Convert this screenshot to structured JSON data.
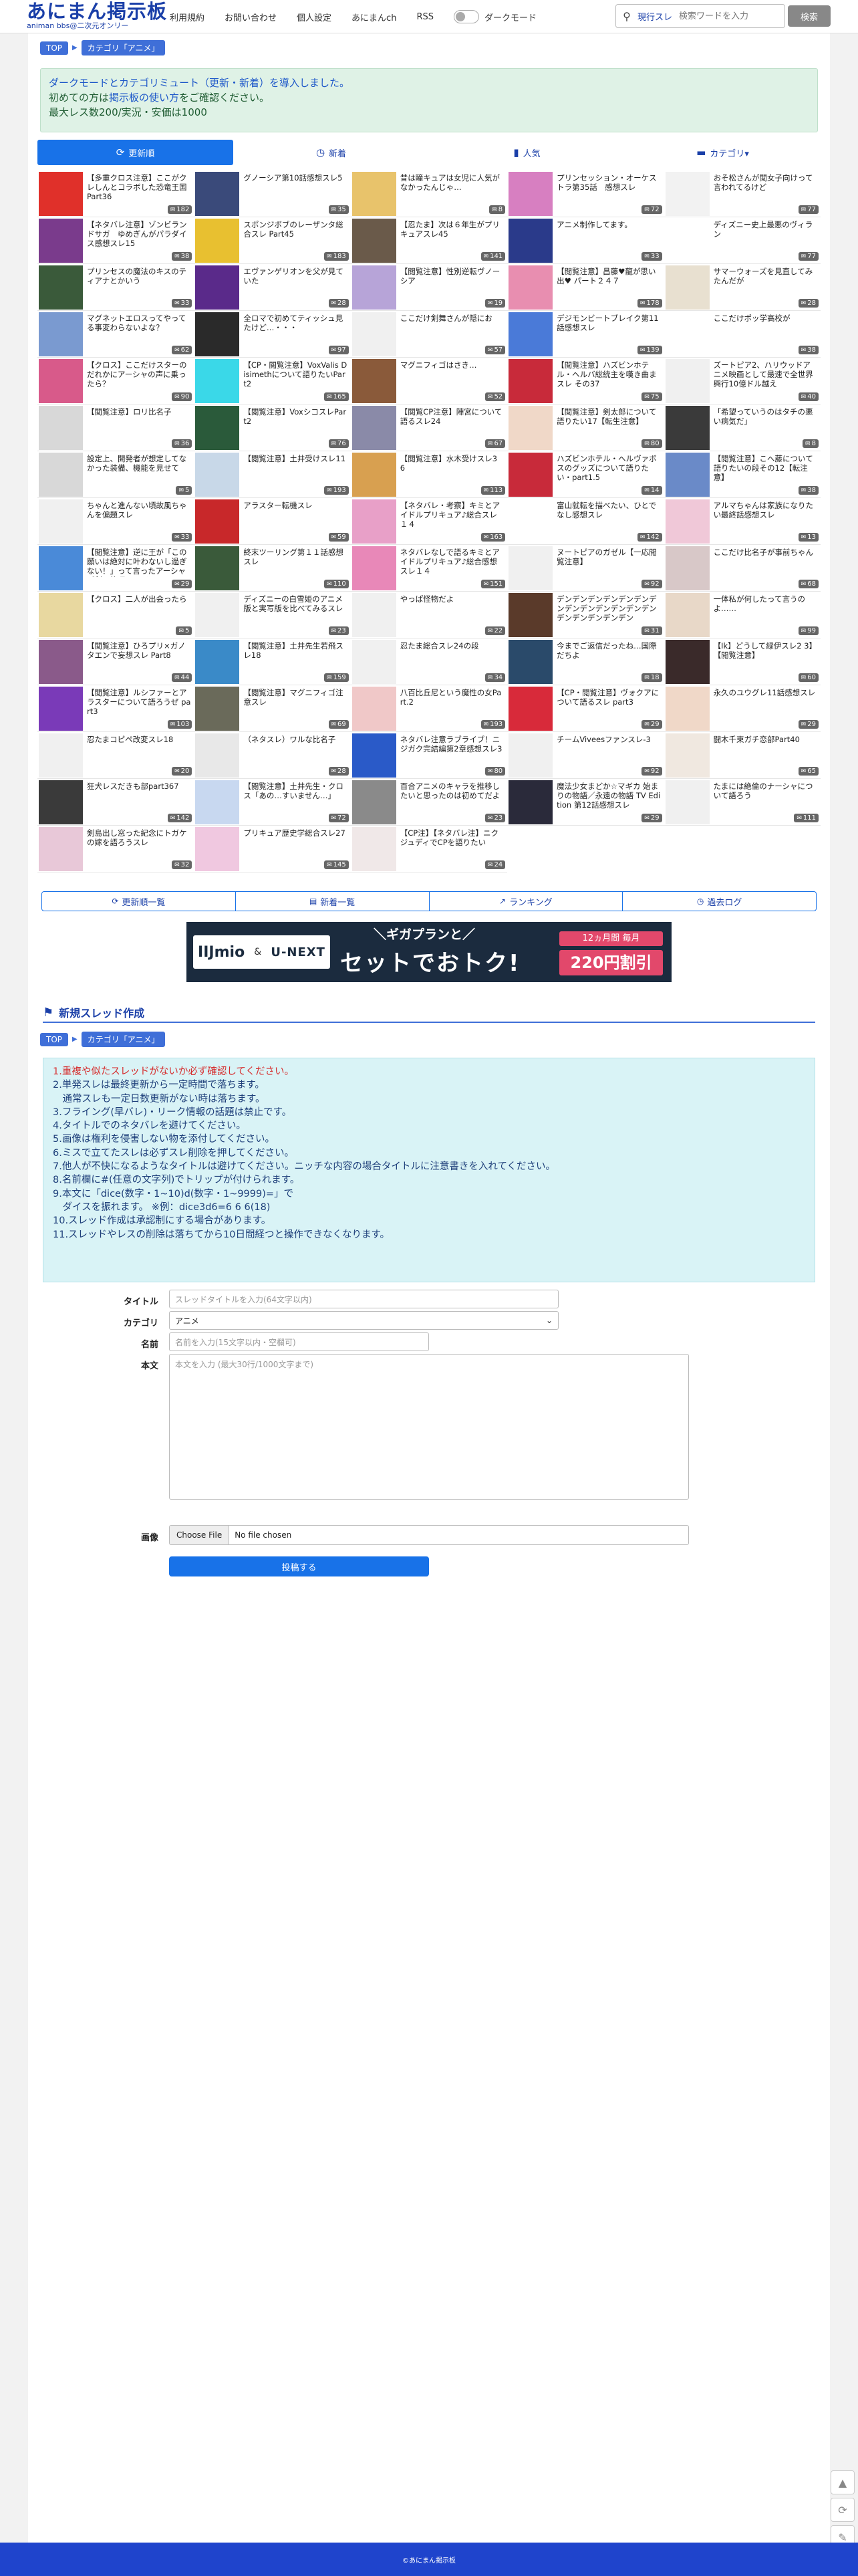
{
  "header": {
    "logo_title": "あにまん掲示板",
    "logo_subtitle": "animan bbs@二次元オンリー",
    "nav": [
      {
        "label": "利用規約"
      },
      {
        "label": "お問い合わせ"
      },
      {
        "label": "個人設定"
      },
      {
        "label": "あにまんch"
      },
      {
        "label": "RSS"
      }
    ],
    "dark_mode_label": "ダークモード",
    "search_mode": "現行スレ",
    "search_placeholder": "検索ワードを入力",
    "search_button": "検索"
  },
  "breadcrumb": {
    "top": "TOP",
    "category": "カテゴリ「アニメ」"
  },
  "notice": {
    "line1": "ダークモードとカテゴリミュート（更新・新着）を導入しました。",
    "line2_pre": "初めての方は",
    "line2_link": "掲示板の使い方",
    "line2_post": "をご確認ください。",
    "line3": "最大レス数200/実況・安価は1000"
  },
  "tabs": [
    {
      "label": "更新順",
      "icon": "⟳"
    },
    {
      "label": "新着",
      "icon": "◷"
    },
    {
      "label": "人気",
      "icon": "▮"
    },
    {
      "label": "カテゴリ▾",
      "icon": "▬"
    }
  ],
  "threads": [
    {
      "title": "【多重クロス注意】ここがクレしんとコラボした恐竜王国Part36",
      "count": "182",
      "thumb": "#e0302a"
    },
    {
      "title": "グノーシア第10話感想スレ5",
      "count": "35",
      "thumb": "#3a4a7a"
    },
    {
      "title": "昔は瞳キュアは女児に人気がなかったんじゃ…",
      "count": "8",
      "thumb": "#e8c36b"
    },
    {
      "title": "プリンセッション・オーケストラ第35話　感想スレ",
      "count": "72",
      "thumb": "#d77fc1"
    },
    {
      "title": "おそ松さんが閲女子向けって言われてるけど",
      "count": "77",
      "thumb": "#f2f2f2"
    },
    {
      "title": "【ネタバレ注意】ゾンビランドサガ　ゆめぎんがパラダイス感想スレ15",
      "count": "38",
      "thumb": "#7a3b8c"
    },
    {
      "title": "スポンジボブのレーザンタ総合スレ Part45",
      "count": "183",
      "thumb": "#e8c030"
    },
    {
      "title": "【忍たま】次は６年生がプリキュアスレ45",
      "count": "141",
      "thumb": "#6a5a4a"
    },
    {
      "title": "アニメ制作してます。",
      "count": "33",
      "thumb": "#2a3a8a"
    },
    {
      "title": "ディズニー史上最悪のヴィラン",
      "count": "77",
      "thumb": "#ffffff"
    },
    {
      "title": "プリンセスの魔法のキスのティアナとかいう",
      "count": "33",
      "thumb": "#3a5a3a"
    },
    {
      "title": "エヴァンゲリオンを父が見ていた",
      "count": "28",
      "thumb": "#5a2a8a"
    },
    {
      "title": "【閲覧注意】性別逆転ヴノーシア",
      "count": "19",
      "thumb": "#b7a4d8"
    },
    {
      "title": "【閲覧注意】昌藤♥龍が思い出♥ パート２４７",
      "count": "178",
      "thumb": "#e88eb0"
    },
    {
      "title": "サマーウォーズを見直してみたんだが",
      "count": "28",
      "thumb": "#e8e0d0"
    },
    {
      "title": "マグネットエロスってやってる事変わらないよな？",
      "count": "62",
      "thumb": "#7a9ad0"
    },
    {
      "title": "全ロマで初めてティッシュ見たけど…・・・",
      "count": "97",
      "thumb": "#2a2a2a"
    },
    {
      "title": "ここだけ剣舞さんが隠にお",
      "count": "57",
      "thumb": "#f0f0f0"
    },
    {
      "title": "デジモンビートブレイク第11話感想スレ",
      "count": "139",
      "thumb": "#4a7ad8"
    },
    {
      "title": "ここだけポッ学高校が",
      "count": "38",
      "thumb": "#ffffff"
    },
    {
      "title": "【クロス】ここだけスターのだれかにアーシャの声に乗ったら？",
      "count": "90",
      "thumb": "#d85a8a"
    },
    {
      "title": "【CP・閲覧注意】VoxValis Disimethについて語りたいPart2",
      "count": "165",
      "thumb": "#3ad8e8"
    },
    {
      "title": "マグニフィゴはさき…",
      "count": "52",
      "thumb": "#8a5a3a"
    },
    {
      "title": "【閲覧注意】ハズビンホテル・ヘルバ総統主を嘆き曲まスレ その37",
      "count": "75",
      "thumb": "#c82a3a"
    },
    {
      "title": "ズートピア2、ハリウッドアニメ映画として最速で全世界興行10億ドル越え",
      "count": "40",
      "thumb": "#f0f0f0"
    },
    {
      "title": "【閲覧注意】ロリ比名子",
      "count": "36",
      "thumb": "#d8d8d8"
    },
    {
      "title": "【閲覧注意】VoxシコスレPart2",
      "count": "76",
      "thumb": "#2a5a3a"
    },
    {
      "title": "【閲覧CP注意】陣宮について語るスレ24",
      "count": "67",
      "thumb": "#8a8aa8"
    },
    {
      "title": "【閲覧注意】剣太郎について語りたい17【転生注意】",
      "count": "80",
      "thumb": "#f0d8c8"
    },
    {
      "title": "「希望っていうのはタチの悪い病気だ」",
      "count": "8",
      "thumb": "#3a3a3a"
    },
    {
      "title": "設定上、開発者が想定してなかった装備、機能を見せて",
      "count": "5",
      "thumb": "#d8d8d8"
    },
    {
      "title": "【閲覧注意】土井受けスレ11",
      "count": "193",
      "thumb": "#c8d8e8"
    },
    {
      "title": "【閲覧注意】水木受けスレ3 6",
      "count": "113",
      "thumb": "#d8a050"
    },
    {
      "title": "ハズビンホテル・ヘルヴァボスのグッズについて語りたい・part1.5",
      "count": "14",
      "thumb": "#c82a3a"
    },
    {
      "title": "【閲覧注意】こへ藤について語りたいの段その12【転注意】",
      "count": "38",
      "thumb": "#6a8ac8"
    },
    {
      "title": "ちゃんと進んない頃故風ちゃんを偏題スレ",
      "count": "33",
      "thumb": "#f0f0f0"
    },
    {
      "title": "アラスター転機スレ",
      "count": "59",
      "thumb": "#c8282a"
    },
    {
      "title": "【ネタバレ・考察】キミとアイドルプリキュア♪総合スレ１４",
      "count": "163",
      "thumb": "#e8a0c8"
    },
    {
      "title": "富山就転を描べたい、ひとでなし感想スレ",
      "count": "142",
      "thumb": "#ffffff"
    },
    {
      "title": "アルマちゃんは家族になりたい最終話感想スレ",
      "count": "13",
      "thumb": "#f0c8d8"
    },
    {
      "title": "【閲覧注意】逆に王が「この願いは絶対に叶わないし過ぎない！」って言ったアーシャが剣る能遅いんだろう？",
      "count": "29",
      "thumb": "#4a8ad8"
    },
    {
      "title": "終末ツーリング第１１話感想スレ",
      "count": "110",
      "thumb": "#3a5a3a"
    },
    {
      "title": "ネタバレなしで語るキミとアイドルプリキュア♪総合感想スレ１４",
      "count": "151",
      "thumb": "#e888b8"
    },
    {
      "title": "ヌートピアのガゼル【一応閲覧注意】",
      "count": "92",
      "thumb": "#f0f0f0"
    },
    {
      "title": "ここだけ比名子が事前ちゃん",
      "count": "68",
      "thumb": "#d8c8c8"
    },
    {
      "title": "【クロス】二人が出会ったら",
      "count": "5",
      "thumb": "#e8d8a0"
    },
    {
      "title": "ディズニーの白雪姫のアニメ版と実写版を比べてみるスレ",
      "count": "23",
      "thumb": "#f0f0f0"
    },
    {
      "title": "やっぱ怪物だよ",
      "count": "22",
      "thumb": "#f0f0f0"
    },
    {
      "title": "デンデンデンデンデンデンデンデンデンデンデンデンデンデンデンデンデンデン",
      "count": "31",
      "thumb": "#5a3a2a"
    },
    {
      "title": "一体私が何したって言うのよ……",
      "count": "99",
      "thumb": "#e8d8c8"
    },
    {
      "title": "【閲覧注意】ひろプリ×ガノタエンで妄想スレ Part8",
      "count": "44",
      "thumb": "#8a5a8a"
    },
    {
      "title": "【閲覧注意】土井先生若飛スレ18",
      "count": "159",
      "thumb": "#3a8ac8"
    },
    {
      "title": "忍たま総合スレ24の段",
      "count": "34",
      "thumb": "#f0f0f0"
    },
    {
      "title": "今までご返信だったね…国際だちよ",
      "count": "18",
      "thumb": "#2a4a6a"
    },
    {
      "title": "【Ik】どうして緑伊スレ2 3】【閲覧注意】",
      "count": "60",
      "thumb": "#3a2a2a"
    },
    {
      "title": "【閲覧注意】ルシファーとアラスターについて語ろうぜ part3",
      "count": "103",
      "thumb": "#7a3ab8"
    },
    {
      "title": "【閲覧注意】マグニフィゴ注意スレ",
      "count": "69",
      "thumb": "#6a6a5a"
    },
    {
      "title": "八百比丘尼という魔性の女Part.2",
      "count": "193",
      "thumb": "#f0c8c8"
    },
    {
      "title": "【CP・閲覧注意】ヴォクアについて語るスレ part3",
      "count": "29",
      "thumb": "#d82a3a"
    },
    {
      "title": "永久のユウグレ11話感想スレ",
      "count": "29",
      "thumb": "#f0d8c8"
    },
    {
      "title": "忍たまコピペ改変スレ18",
      "count": "20",
      "thumb": "#f0f0f0"
    },
    {
      "title": "（ネタスレ）ワルな比名子",
      "count": "28",
      "thumb": "#e8e8e8"
    },
    {
      "title": "ネタバレ注意ラブライブ！ニジガク完結編第2章感想スレ3",
      "count": "80",
      "thumb": "#2a5ac8"
    },
    {
      "title": "チームViveesファンスレ-3",
      "count": "92",
      "thumb": "#f0f0f0"
    },
    {
      "title": "闘木千束ガチ恋部Part40",
      "count": "65",
      "thumb": "#f0e8e0"
    },
    {
      "title": "狂犬レスだきも部part367",
      "count": "142",
      "thumb": "#3a3a3a"
    },
    {
      "title": "【閲覧注意】土井先生・クロス「あの…すいません…」",
      "count": "72",
      "thumb": "#c8d8f0"
    },
    {
      "title": "百合アニメのキャラを推移したいと思ったのは初めてだよ",
      "count": "23",
      "thumb": "#8a8a8a"
    },
    {
      "title": "魔法少女まどか☆マギカ 始まりの物語／永遠の物語 TV Edition 第12話感想スレ",
      "count": "29",
      "thumb": "#2a2a3a"
    },
    {
      "title": "たまには絶倫のナーシャについて語ろう",
      "count": "111",
      "thumb": "#f0f0f0"
    },
    {
      "title": "剣島出し窓った紀念にトガケの嫁を語ろうスレ",
      "count": "32",
      "thumb": "#e8c8d8"
    },
    {
      "title": "プリキュア歴史学総合スレ27",
      "count": "145",
      "thumb": "#f0c8e0"
    },
    {
      "title": "【CP注】【ネタバレ注】ニクジュディでCPを語りたい",
      "count": "24",
      "thumb": "#f0e8e8"
    }
  ],
  "bottom_nav": [
    {
      "label": "更新順一覧",
      "icon": "⟳"
    },
    {
      "label": "新着一覧",
      "icon": "▤"
    },
    {
      "label": "ランキング",
      "icon": "↗"
    },
    {
      "label": "過去ログ",
      "icon": "◷"
    }
  ],
  "ad": {
    "top_text": "＼ギガプランと／",
    "main_text": "セットでおトク!",
    "brand1": "IIJmio",
    "amp": "&",
    "brand2": "U-NEXT",
    "badge1": "12ヵ月間 毎月",
    "badge2": "220円割引"
  },
  "new_thread": {
    "title": "新規スレッド作成",
    "rules": [
      {
        "text": "1.重複や似たスレッドがないか必ず確認してください。",
        "red": true
      },
      {
        "text": "2.単発スレは最終更新から一定時間で落ちます。",
        "red": false
      },
      {
        "text": "　通常スレも一定日数更新がない時は落ちます。",
        "red": false
      },
      {
        "text": "3.フライング(早バレ)・リーク情報の話題は禁止です。",
        "red": false
      },
      {
        "text": "4.タイトルでのネタバレを避けてください。",
        "red": false
      },
      {
        "text": "5.画像は権利を侵害しない物を添付してください。",
        "red": false
      },
      {
        "text": "6.ミスで立てたスレは必ずスレ削除を押してください。",
        "red": false
      },
      {
        "text": "7.他人が不快になるようなタイトルは避けてください。ニッチな内容の場合タイトルに注意書きを入れてください。",
        "red": false
      },
      {
        "text": "8.名前欄に#(任意の文字列)でトリップが付けられます。",
        "red": false
      },
      {
        "text": "9.本文に「dice(数字・1~10)d(数字・1~9999)=」で",
        "red": false
      },
      {
        "text": "　ダイスを振れます。 ※例：dice3d6=6 6 6(18)",
        "red": false
      },
      {
        "text": "10.スレッド作成は承認制にする場合があります。",
        "red": false
      },
      {
        "text": "11.スレッドやレスの削除は落ちてから10日間経つと操作できなくなります。",
        "red": false
      }
    ],
    "title_label": "タイトル",
    "title_placeholder": "スレッドタイトルを入力(64文字以内)",
    "category_label": "カテゴリ",
    "category_value": "アニメ",
    "name_label": "名前",
    "name_placeholder": "名前を入力(15文字以内・空欄可)",
    "body_label": "本文",
    "body_placeholder": "本文を入力 (最大30行/1000文字まで)",
    "image_label": "画像",
    "file_button": "Choose File",
    "file_status": "No file chosen",
    "submit": "投稿する"
  },
  "footer": "©あにまん掲示板"
}
